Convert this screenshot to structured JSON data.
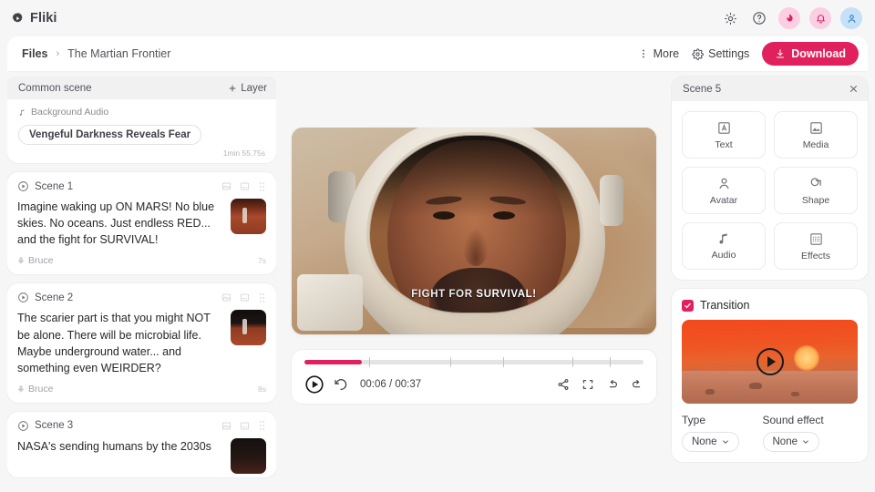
{
  "app": {
    "name": "Fliki",
    "logo_icon": "fliki-gear-play-logo"
  },
  "topbar": {
    "icons": [
      {
        "name": "theme-sun-icon",
        "label": ""
      },
      {
        "name": "help-circle-icon",
        "label": ""
      },
      {
        "name": "flame-icon",
        "label": ""
      },
      {
        "name": "bell-icon",
        "label": ""
      },
      {
        "name": "user-avatar-icon",
        "label": ""
      }
    ]
  },
  "filebar": {
    "crumb_root": "Files",
    "crumb_separator": "›",
    "crumb_current": "The Martian Frontier",
    "more_label": "More",
    "more_icon": "kebab-menu-icon",
    "settings_label": "Settings",
    "settings_icon": "gear-icon",
    "download_label": "Download",
    "download_icon": "download-icon",
    "download_color": "#e0215e"
  },
  "common_scene": {
    "title": "Common scene",
    "add_layer_label": "Layer",
    "add_layer_icon": "plus-icon",
    "background_audio_label": "Background Audio",
    "background_audio_icon": "music-note-icon",
    "track_chip": "Vengeful Darkness Reveals Fear",
    "duration": "1min 55.75s"
  },
  "scenes": [
    {
      "label": "Scene 1",
      "play_icon": "play-circle-icon",
      "tools": [
        "image-icon",
        "subtitle-icon",
        "drag-handle-icon"
      ],
      "text": "Imagine waking up ON MARS! No blue skies. No oceans. Just endless RED... and the fight for SURVIVAL!",
      "voice_icon": "microphone-icon",
      "voice": "Bruce",
      "duration": "7s",
      "thumb_class": "thumb-a"
    },
    {
      "label": "Scene 2",
      "play_icon": "play-circle-icon",
      "tools": [
        "image-icon",
        "subtitle-icon",
        "drag-handle-icon"
      ],
      "text": "The scarier part is that you might NOT be alone. There will be microbial life. Maybe underground water... and something even WEIRDER?",
      "voice_icon": "microphone-icon",
      "voice": "Bruce",
      "duration": "8s",
      "thumb_class": "thumb-b"
    },
    {
      "label": "Scene 3",
      "play_icon": "play-circle-icon",
      "tools": [
        "image-icon",
        "subtitle-icon",
        "drag-handle-icon"
      ],
      "text": "NASA's sending humans by the 2030s",
      "voice_icon": "microphone-icon",
      "voice": "",
      "duration": "",
      "thumb_class": "thumb-c"
    }
  ],
  "preview": {
    "caption_dim": "FIGHT FOR",
    "caption_highlight": "SURVIVAL!"
  },
  "player": {
    "current_time": "00:06",
    "separator": "/",
    "total_time": "00:37",
    "time_display": "00:06 / 00:37",
    "progress_percent": 17,
    "tick_positions": [
      19,
      43,
      58.5,
      79,
      90
    ],
    "play_icon": "play-circle-icon",
    "replay_icon": "replay-icon",
    "share_icon": "share-icon",
    "fullscreen_icon": "fullscreen-icon",
    "undo_icon": "undo-icon",
    "redo_icon": "redo-icon",
    "accent_color": "#e0215e"
  },
  "right_panel": {
    "title": "Scene 5",
    "close_icon": "close-icon",
    "tiles": [
      {
        "label": "Text",
        "icon": "text-box-icon"
      },
      {
        "label": "Media",
        "icon": "image-icon"
      },
      {
        "label": "Avatar",
        "icon": "avatar-person-icon"
      },
      {
        "label": "Shape",
        "icon": "shape-icon"
      },
      {
        "label": "Audio",
        "icon": "music-note-icon"
      },
      {
        "label": "Effects",
        "icon": "effects-grid-icon"
      }
    ],
    "transition": {
      "label": "Transition",
      "checked": true,
      "checkbox_color": "#e0215e",
      "preview_play_icon": "play-circle-icon",
      "type_label": "Type",
      "type_value": "None",
      "sound_label": "Sound effect",
      "sound_value": "None",
      "chevron_icon": "chevron-down-icon"
    }
  }
}
